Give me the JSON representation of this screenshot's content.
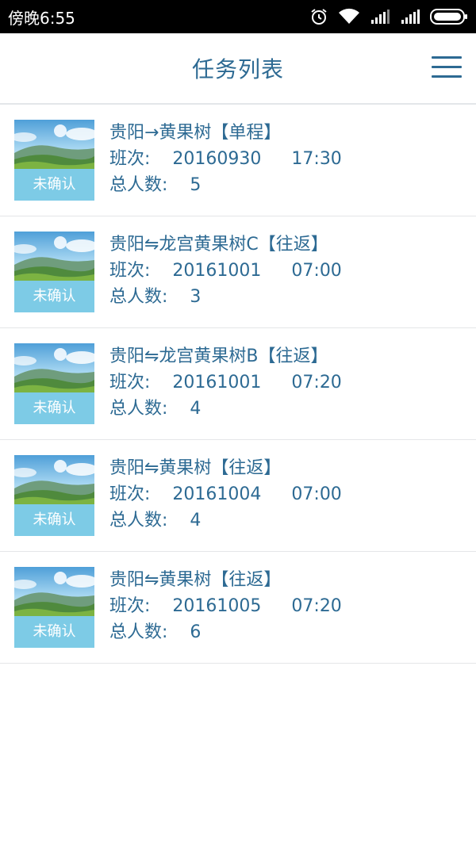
{
  "status_bar": {
    "time": "傍晚6:55"
  },
  "header": {
    "title": "任务列表",
    "menu_icon": "hamburger-menu-icon"
  },
  "tasks": [
    {
      "route": "贵阳→黄果树【单程】",
      "shift_label": "班次:",
      "date": "20160930",
      "time": "17:30",
      "count_label": "总人数:",
      "count": "5",
      "status": "未确认"
    },
    {
      "route": "贵阳⇋龙宫黄果树C【往返】",
      "shift_label": "班次:",
      "date": "20161001",
      "time": "07:00",
      "count_label": "总人数:",
      "count": "3",
      "status": "未确认"
    },
    {
      "route": "贵阳⇋龙宫黄果树B【往返】",
      "shift_label": "班次:",
      "date": "20161001",
      "time": "07:20",
      "count_label": "总人数:",
      "count": "4",
      "status": "未确认"
    },
    {
      "route": "贵阳⇋黄果树【往返】",
      "shift_label": "班次:",
      "date": "20161004",
      "time": "07:00",
      "count_label": "总人数:",
      "count": "4",
      "status": "未确认"
    },
    {
      "route": "贵阳⇋黄果树【往返】",
      "shift_label": "班次:",
      "date": "20161005",
      "time": "07:20",
      "count_label": "总人数:",
      "count": "6",
      "status": "未确认"
    }
  ]
}
